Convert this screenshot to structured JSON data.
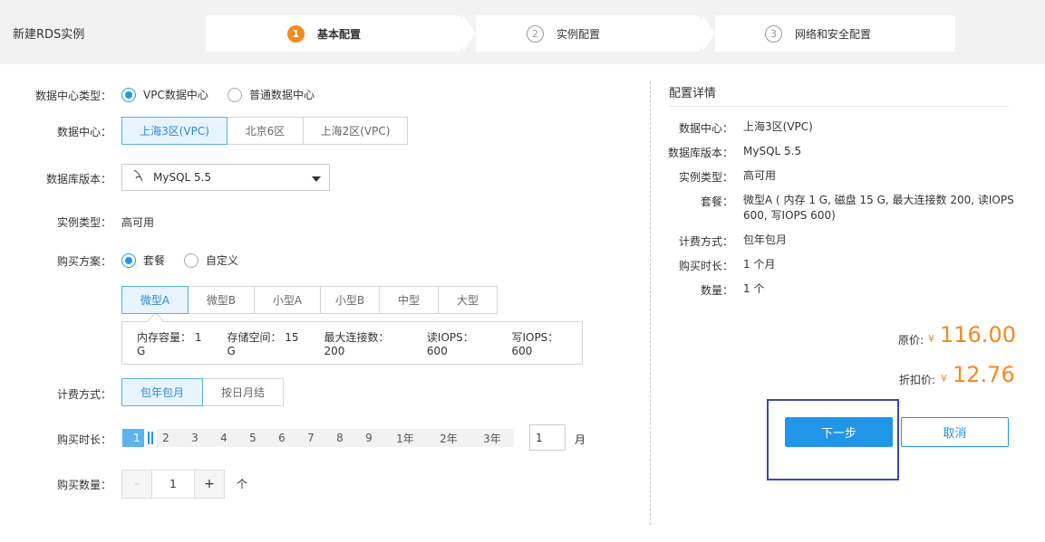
{
  "page": {
    "title": "新建RDS实例"
  },
  "steps": [
    {
      "num": "1",
      "label": "基本配置"
    },
    {
      "num": "2",
      "label": "实例配置"
    },
    {
      "num": "3",
      "label": "网络和安全配置"
    }
  ],
  "form": {
    "dc_type": {
      "label": "数据中心类型：",
      "options": [
        "VPC数据中心",
        "普通数据中心"
      ],
      "selected": "VPC数据中心"
    },
    "dc": {
      "label": "数据中心：",
      "options": [
        "上海3区(VPC)",
        "北京6区",
        "上海2区(VPC)"
      ],
      "selected": "上海3区(VPC)"
    },
    "db_version": {
      "label": "数据库版本：",
      "value": "MySQL 5.5",
      "icon": "mysql-dolphin-icon"
    },
    "instance_type": {
      "label": "实例类型：",
      "value": "高可用"
    },
    "plan": {
      "label": "购买方案：",
      "options": [
        "套餐",
        "自定义"
      ],
      "selected": "套餐"
    },
    "package": {
      "options": [
        "微型A",
        "微型B",
        "小型A",
        "小型B",
        "中型",
        "大型"
      ],
      "selected": "微型A",
      "specs": [
        "内存容量： 1 G",
        "存储空间： 15 G",
        "最大连接数： 200",
        "读IOPS： 600",
        "写IOPS： 600"
      ]
    },
    "billing": {
      "label": "计费方式：",
      "options": [
        "包年包月",
        "按日月结"
      ],
      "selected": "包年包月"
    },
    "duration": {
      "label": "购买时长：",
      "ticks": [
        "1",
        "2",
        "3",
        "4",
        "5",
        "6",
        "7",
        "8",
        "9",
        "1年",
        "2年",
        "3年"
      ],
      "selected": "1",
      "input_value": "1",
      "unit": "月"
    },
    "quantity": {
      "label": "购买数量：",
      "minus": "-",
      "value": "1",
      "plus": "+",
      "unit": "个"
    }
  },
  "summary": {
    "title": "配置详情",
    "items": [
      {
        "k": "数据中心：",
        "v": "上海3区(VPC)"
      },
      {
        "k": "数据库版本：",
        "v": "MySQL 5.5"
      },
      {
        "k": "实例类型：",
        "v": "高可用"
      },
      {
        "k": "套餐：",
        "v": "微型A ( 内存 1 G, 磁盘 15 G, 最大连接数 200, 读IOPS 600, 写IOPS 600)"
      },
      {
        "k": "计费方式：",
        "v": "包年包月"
      },
      {
        "k": "购买时长：",
        "v": "1 个月"
      },
      {
        "k": "数量：",
        "v": "1 个"
      }
    ],
    "original_price_label": "原价:",
    "original_price": "116.00",
    "discount_price_label": "折扣价:",
    "discount_price": "12.76",
    "currency": "¥"
  },
  "actions": {
    "next": "下一步",
    "cancel": "取消"
  },
  "colors": {
    "accent": "#2196e8",
    "price": "#f5891f",
    "step_active": "#f5891f"
  }
}
